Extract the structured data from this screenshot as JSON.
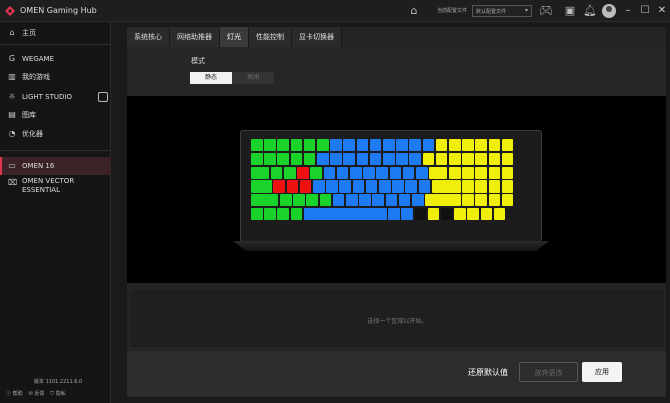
{
  "app": {
    "title": "OMEN Gaming Hub"
  },
  "titlebar": {
    "profile_label": "当前配置文件",
    "profile_value": "默认配置文件",
    "icons": [
      "home-icon",
      "controller-icon",
      "monitor-icon",
      "bell-icon",
      "avatar",
      "minimize-icon",
      "maximize-icon",
      "close-icon"
    ]
  },
  "sidebar": {
    "items": [
      {
        "label": "主页",
        "icon": "home-icon"
      },
      {
        "label": "WEGAME",
        "icon": "wegame-icon"
      },
      {
        "label": "我的游戏",
        "icon": "library-icon"
      },
      {
        "label": "LIGHT STUDIO",
        "icon": "light-icon"
      },
      {
        "label": "图库",
        "icon": "gallery-icon"
      },
      {
        "label": "优化器",
        "icon": "optimizer-icon"
      }
    ],
    "devices": [
      {
        "label": "OMEN 16",
        "icon": "laptop-icon"
      },
      {
        "label": "OMEN VECTOR ESSENTIAL",
        "icon": "mouse-icon"
      }
    ],
    "version_label": "版本",
    "version_value": "1101.2211.6.0",
    "footer": [
      "帮助",
      "反馈",
      "隐私"
    ]
  },
  "tabs": [
    {
      "label": "系统核心"
    },
    {
      "label": "网络助推器"
    },
    {
      "label": "灯光"
    },
    {
      "label": "性能控制"
    },
    {
      "label": "显卡切换器"
    }
  ],
  "active_tab": "灯光",
  "mode": {
    "label": "模式",
    "options": [
      "静态",
      "关闭"
    ],
    "selected": "静态"
  },
  "keyboard": {
    "colors": {
      "green": "#19d32a",
      "blue": "#1e7af0",
      "yellow": "#f2ee0c",
      "red": "#ee1111",
      "dark": "#111111"
    },
    "zones": [
      "green",
      "blue",
      "yellow",
      "red"
    ]
  },
  "info": {
    "text": "选择一个区域以开始。"
  },
  "actions": {
    "reset": "还原默认值",
    "undo": "放弃更改",
    "apply": "应用"
  }
}
